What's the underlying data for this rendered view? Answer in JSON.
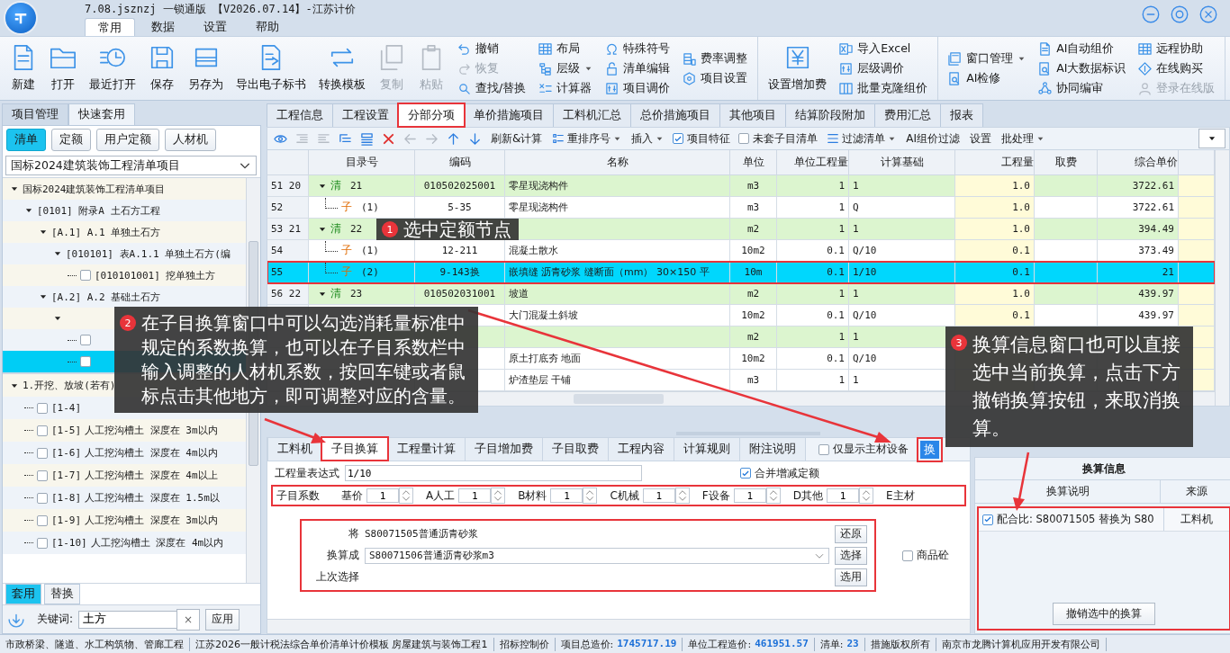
{
  "window": {
    "title": "7.08.jsznzj 一锁通版 【V2026.07.14】-江苏计价"
  },
  "menu_tabs": [
    {
      "label": "常用",
      "selected": true
    },
    {
      "label": "数据",
      "selected": false
    },
    {
      "label": "设置",
      "selected": false
    },
    {
      "label": "帮助",
      "selected": false
    }
  ],
  "ribbon": [
    {
      "large": [
        {
          "label": "新建",
          "disabled": false
        },
        {
          "label": "打开",
          "disabled": false
        },
        {
          "label": "最近打开",
          "disabled": false
        },
        {
          "label": "保存",
          "disabled": false
        },
        {
          "label": "另存为",
          "disabled": false
        },
        {
          "label": "导出电子标书",
          "disabled": false
        },
        {
          "label": "转换模板",
          "disabled": false
        },
        {
          "label": "复制",
          "disabled": true
        },
        {
          "label": "粘贴",
          "disabled": true
        }
      ],
      "columns": [
        [
          {
            "label": "撤销",
            "disabled": false,
            "dropdown": false
          },
          {
            "label": "恢复",
            "disabled": true,
            "dropdown": false
          },
          {
            "label": "查找/替换",
            "disabled": false,
            "dropdown": false
          }
        ],
        [
          {
            "label": "布局",
            "disabled": false,
            "dropdown": false
          },
          {
            "label": "层级",
            "disabled": false,
            "dropdown": true
          },
          {
            "label": "计算器",
            "disabled": false,
            "dropdown": false
          }
        ],
        [
          {
            "label": "特殊符号",
            "disabled": false,
            "dropdown": false
          },
          {
            "label": "清单编辑",
            "disabled": false,
            "dropdown": false
          },
          {
            "label": "项目调价",
            "disabled": false,
            "dropdown": false
          }
        ],
        [
          {
            "label": "费率调整",
            "disabled": false,
            "dropdown": false
          },
          {
            "label": "项目设置",
            "disabled": false,
            "dropdown": false
          }
        ]
      ]
    },
    {
      "large": [
        {
          "label": "设置增加费",
          "disabled": false
        }
      ],
      "columns": [
        [
          {
            "label": "导入Excel",
            "disabled": false,
            "dropdown": false
          },
          {
            "label": "层级调价",
            "disabled": false,
            "dropdown": false
          },
          {
            "label": "批量克隆组价",
            "disabled": false,
            "dropdown": false
          }
        ]
      ]
    },
    {
      "columns": [
        [
          {
            "label": "窗口管理",
            "disabled": false,
            "dropdown": true
          },
          {
            "label": "AI检修",
            "disabled": false,
            "dropdown": false
          }
        ],
        [
          {
            "label": "AI自动组价",
            "disabled": false,
            "dropdown": false
          },
          {
            "label": "AI大数据标识",
            "disabled": false,
            "dropdown": false
          },
          {
            "label": "协同编审",
            "disabled": false,
            "dropdown": false
          }
        ],
        [
          {
            "label": "远程协助",
            "disabled": false,
            "dropdown": false
          },
          {
            "label": "在线购买",
            "disabled": false,
            "dropdown": false
          },
          {
            "label": "登录在线版",
            "disabled": true,
            "dropdown": false
          }
        ]
      ]
    }
  ],
  "left_panel": {
    "tabs": [
      {
        "label": "项目管理",
        "selected": false
      },
      {
        "label": "快速套用",
        "selected": true
      }
    ],
    "filter_buttons": [
      {
        "label": "清单",
        "selected": true
      },
      {
        "label": "定额",
        "selected": false
      },
      {
        "label": "用户定额",
        "selected": false
      },
      {
        "label": "人材机",
        "selected": false
      }
    ],
    "library": "国标2024建筑装饰工程清单项目",
    "tree": [
      {
        "kind": "group",
        "label": "国标2024建筑装饰工程清单项目",
        "expanded": true,
        "children": [
          {
            "kind": "group",
            "label": "[0101] 附录A 土石方工程",
            "expanded": true,
            "children": [
              {
                "kind": "group",
                "label": "[A.1] A.1 单独土石方",
                "expanded": true,
                "children": [
                  {
                    "kind": "group",
                    "label": "[010101] 表A.1.1 单独土石方(编",
                    "expanded": true,
                    "children": [
                      {
                        "kind": "leaf",
                        "label": "[010101001] 挖单独土方",
                        "checked": false,
                        "selected": false
                      }
                    ]
                  }
                ]
              },
              {
                "kind": "group",
                "label": "[A.2] A.2 基础土石方",
                "expanded": true,
                "children": [
                  {
                    "kind": "group",
                    "expanded": true,
                    "children": [
                      {
                        "kind": "leaf",
                        "checked": false,
                        "selected": false
                      },
                      {
                        "kind": "leaf",
                        "checked": false,
                        "selected": true
                      }
                    ]
                  }
                ]
              }
            ]
          }
        ]
      }
    ],
    "quota_tree": [
      {
        "kind": "group",
        "label": "1.开挖、放坡(若有)",
        "expanded": true,
        "children": [
          {
            "kind": "leaf",
            "code": "[1-4]",
            "checked": false,
            "selected": false
          },
          {
            "kind": "leaf",
            "code": "[1-5]",
            "name": "人工挖沟槽土 深度在 3m以内",
            "checked": false,
            "selected": false
          },
          {
            "kind": "leaf",
            "code": "[1-6]",
            "name": "人工挖沟槽土 深度在 4m以内",
            "checked": false,
            "selected": false
          },
          {
            "kind": "leaf",
            "code": "[1-7]",
            "name": "人工挖沟槽土 深度在 4m以上",
            "checked": false,
            "selected": false
          },
          {
            "kind": "leaf",
            "code": "[1-8]",
            "name": "人工挖沟槽土 深度在 1.5m以",
            "checked": false,
            "selected": false
          },
          {
            "kind": "leaf",
            "code": "[1-9]",
            "name": "人工挖沟槽土 深度在 3m以内",
            "checked": false,
            "selected": false
          },
          {
            "kind": "leaf",
            "code": "[1-10]",
            "name": "人工挖沟槽土 深度在 4m以内",
            "checked": false,
            "selected": false
          }
        ]
      }
    ],
    "bottom_tabs": [
      {
        "label": "套用",
        "selected": true
      },
      {
        "label": "替换",
        "selected": false
      }
    ],
    "keyword": {
      "label": "关键词:",
      "value": "土方",
      "clear": "×",
      "apply": "应用"
    }
  },
  "main_tabs": [
    {
      "label": "工程信息",
      "selected": false,
      "highlighted": false
    },
    {
      "label": "工程设置",
      "selected": false,
      "highlighted": false
    },
    {
      "label": "分部分项",
      "selected": true,
      "highlighted": true
    },
    {
      "label": "单价措施项目",
      "selected": false,
      "highlighted": false
    },
    {
      "label": "工料机汇总",
      "selected": false,
      "highlighted": false
    },
    {
      "label": "总价措施项目",
      "selected": false,
      "highlighted": false
    },
    {
      "label": "其他项目",
      "selected": false,
      "highlighted": false
    },
    {
      "label": "结算阶段附加",
      "selected": false,
      "highlighted": false
    },
    {
      "label": "费用汇总",
      "selected": false,
      "highlighted": false
    },
    {
      "label": "报表",
      "selected": false,
      "highlighted": false
    }
  ],
  "toolbar": {
    "icon_buttons": [
      {
        "disabled": false
      },
      {
        "disabled": true
      },
      {
        "disabled": true
      },
      {
        "disabled": false
      },
      {
        "disabled": false
      },
      {
        "disabled": false
      },
      {
        "disabled": true
      },
      {
        "disabled": true
      },
      {
        "disabled": false
      },
      {
        "disabled": false
      }
    ],
    "items": [
      {
        "kind": "button",
        "label": "刷新&计算"
      },
      {
        "kind": "menu",
        "label": "重排序号"
      },
      {
        "kind": "menu",
        "label": "插入"
      },
      {
        "kind": "checkbox",
        "label": "项目特征",
        "checked": true
      },
      {
        "kind": "checkbox",
        "label": "未套子目清单",
        "checked": false
      },
      {
        "kind": "menu",
        "label": "过滤清单"
      },
      {
        "kind": "button",
        "label": "AI组价过滤"
      },
      {
        "kind": "button",
        "label": "设置"
      },
      {
        "kind": "menu",
        "label": "批处理"
      }
    ]
  },
  "table": {
    "columns": [
      "目录号",
      "编码",
      "名称",
      "单位",
      "单位工程量",
      "计算基础",
      "工程量",
      "取费",
      "综合单价"
    ],
    "rows": [
      {
        "number": "51 20",
        "kind": "list",
        "mark": "清",
        "dir": "21",
        "code": "010502025001",
        "name": "零星现浇构件",
        "unit": "m3",
        "unit_qty": "1",
        "base": "1",
        "qty": "1.0",
        "price": "3722.61",
        "selected": false,
        "highlighted": false
      },
      {
        "number": "52",
        "kind": "item",
        "mark": "子",
        "dir": "(1)",
        "code": "5-35",
        "name": "零星现浇构件",
        "unit": "m3",
        "unit_qty": "1",
        "base": "Q",
        "qty": "1.0",
        "price": "3722.61",
        "selected": false,
        "highlighted": false
      },
      {
        "number": "53 21",
        "kind": "list",
        "mark": "清",
        "dir": "22",
        "unit": "m2",
        "unit_qty": "1",
        "base": "1",
        "qty": "1.0",
        "price": "394.49",
        "selected": false,
        "highlighted": false
      },
      {
        "number": "54",
        "kind": "item",
        "mark": "子",
        "dir": "(1)",
        "code": "12-211",
        "name": "混凝土散水",
        "unit": "10m2",
        "unit_qty": "0.1",
        "base": "Q/10",
        "qty": "0.1",
        "price": "373.49",
        "selected": false,
        "highlighted": false
      },
      {
        "number": "55",
        "kind": "item",
        "mark": "子",
        "dir": "(2)",
        "code": "9-143换",
        "name": "嵌填缝 沥青砂浆 缝断面（mm） 30×150 平",
        "unit": "10m",
        "unit_qty": "0.1",
        "base": "1/10",
        "qty": "0.1",
        "price": "21",
        "selected": true,
        "highlighted": true
      },
      {
        "number": "56 22",
        "kind": "list",
        "mark": "清",
        "dir": "23",
        "code": "010502031001",
        "name": "坡道",
        "unit": "m2",
        "unit_qty": "1",
        "base": "1",
        "qty": "1.0",
        "price": "439.97",
        "selected": false,
        "highlighted": false
      },
      {
        "kind": "item",
        "name": "大门混凝土斜坡",
        "unit": "10m2",
        "unit_qty": "0.1",
        "base": "Q/10",
        "qty": "0.1",
        "price": "439.97",
        "selected": false,
        "highlighted": false
      },
      {
        "kind": "list",
        "unit": "m2",
        "unit_qty": "1",
        "base": "1",
        "selected": false,
        "highlighted": false
      },
      {
        "kind": "item",
        "name": "原土打底夯 地面",
        "unit": "10m2",
        "unit_qty": "0.1",
        "base": "Q/10",
        "selected": false,
        "highlighted": false
      },
      {
        "kind": "item",
        "name": "炉渣垫层 干铺",
        "unit": "m3",
        "unit_qty": "1",
        "base": "1",
        "selected": false,
        "highlighted": false
      }
    ]
  },
  "detail_tabs": [
    {
      "label": "工料机",
      "selected": false,
      "highlighted": false
    },
    {
      "label": "子目换算",
      "selected": true,
      "highlighted": true
    },
    {
      "label": "工程量计算",
      "selected": false,
      "highlighted": false
    },
    {
      "label": "子目增加费",
      "selected": false,
      "highlighted": false
    },
    {
      "label": "子目取费",
      "selected": false,
      "highlighted": false
    },
    {
      "label": "工程内容",
      "selected": false,
      "highlighted": false
    },
    {
      "label": "计算规则",
      "selected": false,
      "highlighted": false
    },
    {
      "label": "附注说明",
      "selected": false,
      "highlighted": false
    }
  ],
  "main_only": {
    "label": "仅显示主材设备",
    "checked": false
  },
  "convert_button": "换",
  "expression": {
    "label": "工程量表达式",
    "value": "1/10"
  },
  "merge": {
    "label": "合并增减定额",
    "checked": true
  },
  "coefficients": {
    "label": "子目系数",
    "items": [
      {
        "label": "基价",
        "value": "1"
      },
      {
        "label": "A人工",
        "value": "1"
      },
      {
        "label": "B材料",
        "value": "1"
      },
      {
        "label": "C机械",
        "value": "1"
      },
      {
        "label": "F设备",
        "value": "1"
      },
      {
        "label": "D其他",
        "value": "1"
      },
      {
        "label": "E主材"
      }
    ]
  },
  "replace": {
    "from_label": "将",
    "from_value": "S80071505普通沥青砂浆",
    "restore_button": "还原",
    "to_label": "换算成",
    "to_value": "S80071506普通沥青砂浆m3",
    "choose_button": "选择",
    "last_label": "上次选择",
    "use_button": "选用"
  },
  "commercial_concrete": {
    "label": "商品砼",
    "checked": false
  },
  "info_panel": {
    "title": "换算信息",
    "columns": [
      "换算说明",
      "来源"
    ],
    "rows": [
      {
        "checked": true,
        "description": "配合比: S80071505 替换为 S80",
        "source": "工料机"
      }
    ],
    "undo_button": "撤销选中的换算"
  },
  "status_bar": [
    {
      "label": "市政桥梁、隧道、水工构筑物、管廊工程"
    },
    {
      "label": "江苏2026一般计税法综合单价清单计价模板 房屋建筑与装饰工程1"
    },
    {
      "label": "招标控制价"
    },
    {
      "label": "项目总造价:",
      "value": "1745717.19"
    },
    {
      "label": "单位工程造价:",
      "value": "461951.57"
    },
    {
      "label": "清单:",
      "value": "23"
    },
    {
      "label": "措施版权所有"
    },
    {
      "label": "南京市龙腾计算机应用开发有限公司"
    }
  ],
  "callouts": [
    {
      "number": "1",
      "text": "选中定额节点"
    },
    {
      "number": "2",
      "text": "在子目换算窗口中可以勾选消耗量标准中规定的系数换算，也可以在子目系数栏中输入调整的人材机系数，按回车键或者鼠标点击其他地方，即可调整对应的含量。"
    },
    {
      "number": "3",
      "text": "换算信息窗口也可以直接选中当前换算，点击下方撤销换算按钮，来取消换算。"
    }
  ]
}
